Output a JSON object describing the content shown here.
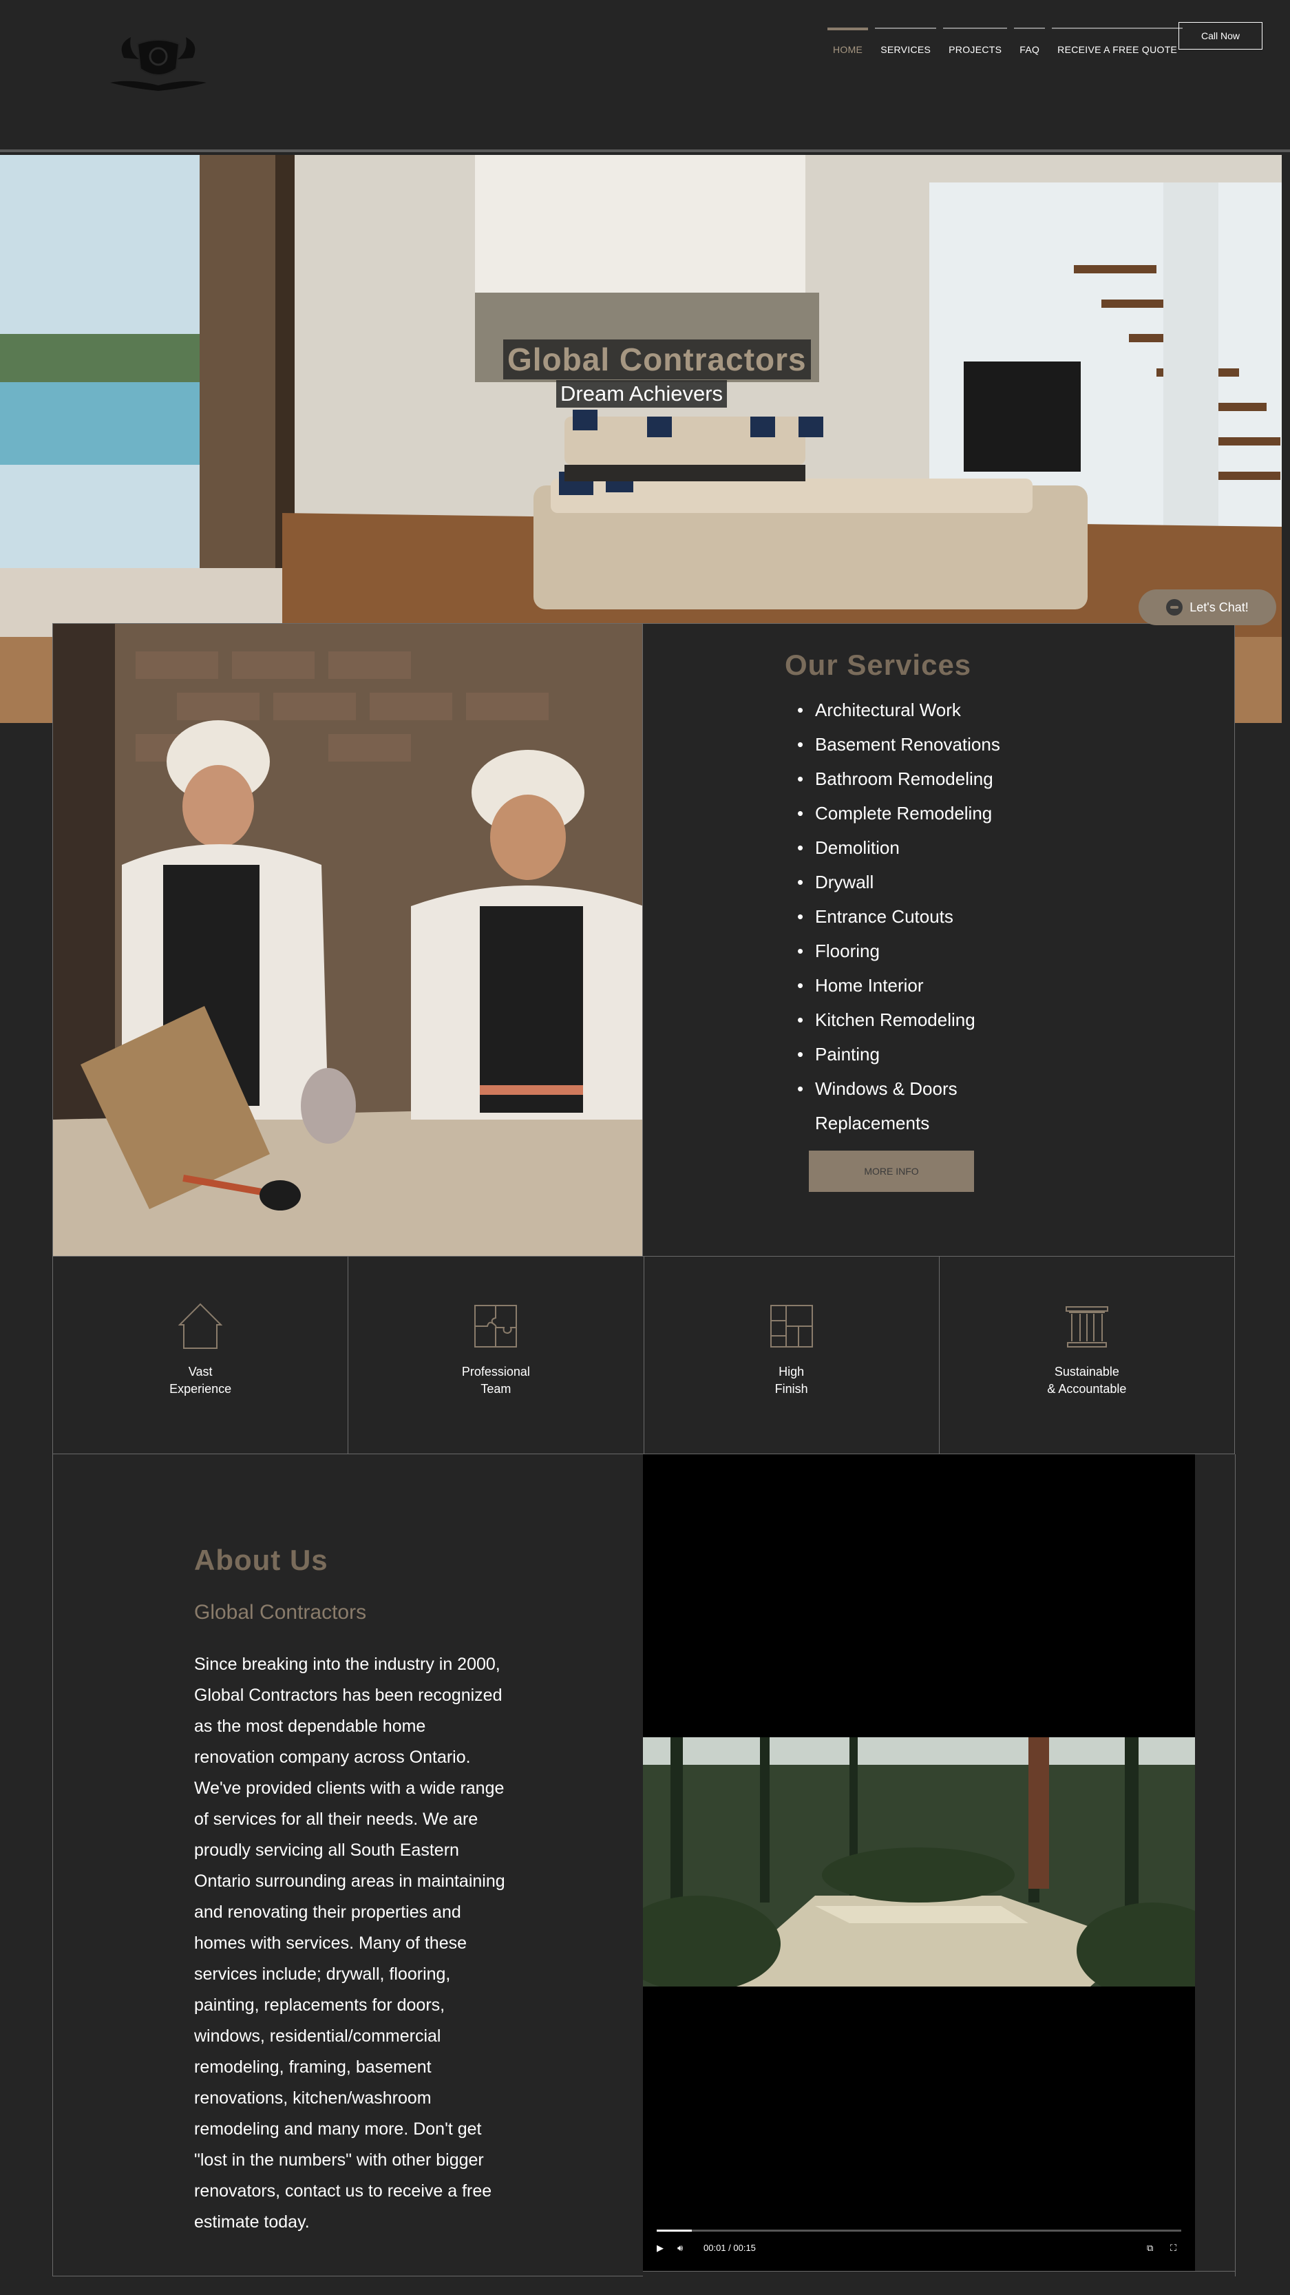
{
  "header": {
    "nav": [
      {
        "label": "HOME",
        "active": true
      },
      {
        "label": "SERVICES",
        "active": false
      },
      {
        "label": "PROJECTS",
        "active": false
      },
      {
        "label": "FAQ",
        "active": false
      },
      {
        "label": "RECEIVE A FREE QUOTE",
        "active": false
      }
    ],
    "call_button": "Call Now",
    "logo_icon": "crest-logo-icon"
  },
  "hero": {
    "title": "Global Contractors",
    "subtitle": "Dream Achievers"
  },
  "chat": {
    "label": "Let's Chat!"
  },
  "services": {
    "title": "Our Services",
    "items": [
      "Architectural Work",
      "Basement Renovations",
      "Bathroom Remodeling",
      "Complete Remodeling",
      "Demolition",
      "Drywall",
      "Entrance Cutouts",
      "Flooring",
      "Home Interior",
      "Kitchen Remodeling",
      "Painting",
      "Windows & Doors Replacements"
    ],
    "more_button": "MORE INFO"
  },
  "features": [
    {
      "icon": "house-icon",
      "line1": "Vast",
      "line2": "Experience"
    },
    {
      "icon": "puzzle-icon",
      "line1": "Professional",
      "line2": "Team"
    },
    {
      "icon": "tiles-icon",
      "line1": "High",
      "line2": "Finish"
    },
    {
      "icon": "column-icon",
      "line1": "Sustainable",
      "line2": "& Accountable"
    }
  ],
  "about": {
    "title": "About Us",
    "subtitle": "Global Contractors",
    "text": "Since breaking into the industry in 2000, Global Contractors has been recognized as the most dependable home renovation company across Ontario. We've provided clients with a wide range of services for all their needs. We are proudly servicing all South Eastern Ontario surrounding areas in maintaining and renovating their properties and homes with services. Many of these services include; drywall, flooring, painting, replacements for doors, windows, residential/commercial remodeling, framing, basement renovations, kitchen/washroom remodeling and many more. Don't get \"lost in the numbers\" with other bigger renovators, contact us to receive a free estimate today."
  },
  "video": {
    "time": "00:01 / 00:15",
    "progress": 0.067
  },
  "colors": {
    "background": "#252525",
    "accent": "#8a7c6b",
    "accent_text": "#7a6c5b"
  }
}
